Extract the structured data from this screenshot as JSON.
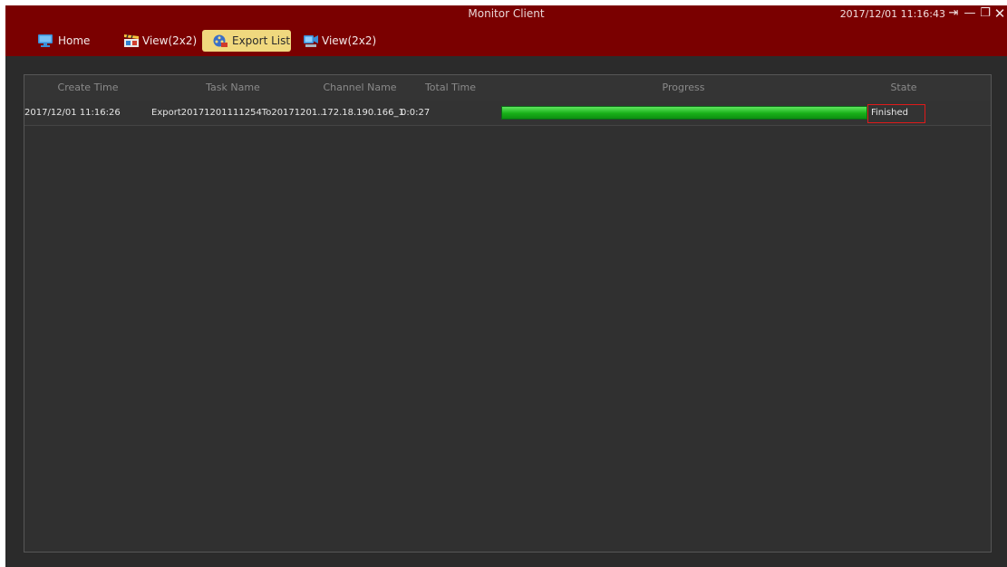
{
  "app": {
    "title": "Monitor Client",
    "clock": "2017/12/01 11:16:43",
    "window_controls": {
      "logout": "⇥",
      "minimize": "—",
      "restore": "❐",
      "close": "✕"
    }
  },
  "tabs": [
    {
      "label": "Home",
      "icon": "monitor-icon",
      "active": false
    },
    {
      "label": "View(2x2)",
      "icon": "clapperboard-icon",
      "active": false
    },
    {
      "label": "Export List",
      "icon": "export-reel-icon",
      "active": true
    },
    {
      "label": "View(2x2)",
      "icon": "video-camera-icon",
      "active": false
    }
  ],
  "table": {
    "columns": [
      "Create Time",
      "Task Name",
      "Channel Name",
      "Total Time",
      "Progress",
      "State"
    ],
    "rows": [
      {
        "create_time": "2017/12/01 11:16:26",
        "task_name": "Export20171201111254To20171201...",
        "channel_name": "172.18.190.166_1",
        "total_time": "0:0:27",
        "progress_percent": 100,
        "state": "Finished"
      }
    ]
  },
  "colors": {
    "titlebar": "#7a0000",
    "active_tab": "#f0d87e",
    "progress": "#18b018",
    "highlight_border": "#e01a1a",
    "background": "#2b2b2b"
  }
}
